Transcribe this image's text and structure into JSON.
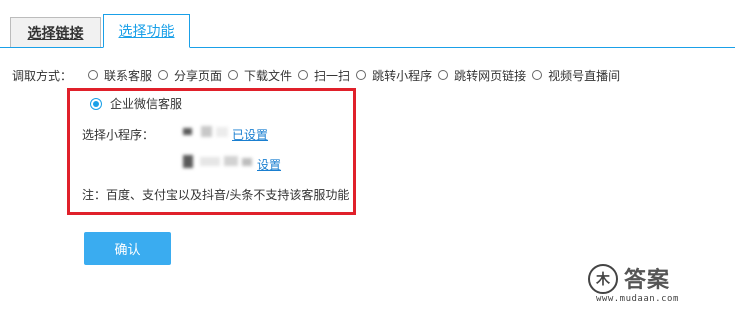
{
  "tabs": [
    {
      "label": "选择链接",
      "active": false
    },
    {
      "label": "选择功能",
      "active": true
    }
  ],
  "method": {
    "label": "调取方式：",
    "options": [
      {
        "label": "联系客服"
      },
      {
        "label": "分享页面"
      },
      {
        "label": "下载文件"
      },
      {
        "label": "扫一扫"
      },
      {
        "label": "跳转小程序"
      },
      {
        "label": "跳转网页链接"
      },
      {
        "label": "视频号直播间"
      }
    ]
  },
  "kefu": {
    "option_label": "企业微信客服",
    "selected": true,
    "mini_program_label": "选择小程序：",
    "link_set": "已设置",
    "link_setup": "设置",
    "note": "注：百度、支付宝以及抖音/头条不支持该客服功能"
  },
  "confirm_label": "确认",
  "watermark": {
    "title": "答案",
    "logo_glyph": "木",
    "url": "www.mudaan.com"
  },
  "colors": {
    "accent": "#1aa0e8",
    "highlight_border": "#e0202a",
    "button": "#3aacf0",
    "link": "#1a7fd0"
  }
}
